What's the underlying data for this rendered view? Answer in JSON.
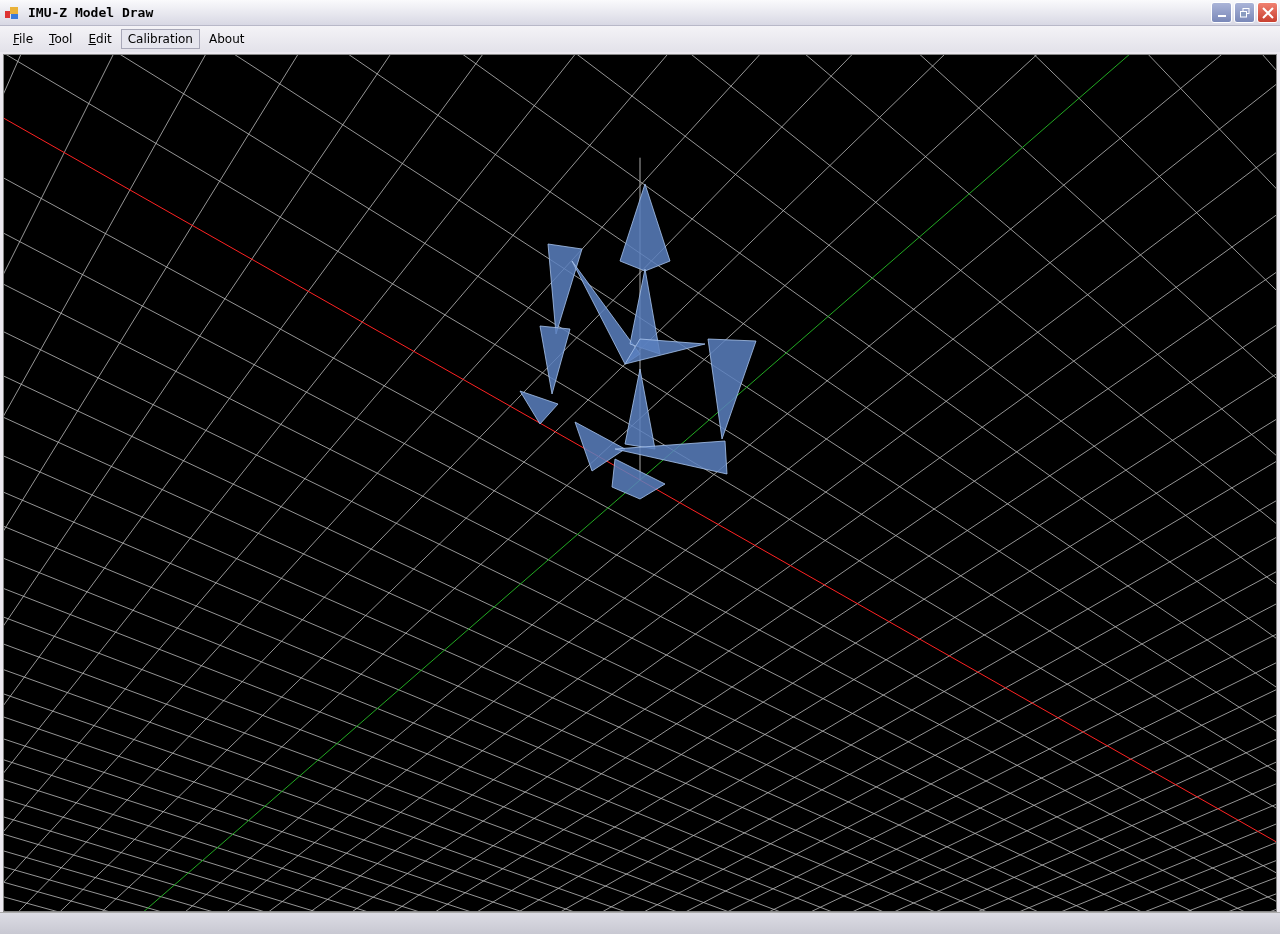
{
  "window": {
    "title": "IMU-Z Model Draw"
  },
  "menu": [
    {
      "label": "File",
      "underline_first": true,
      "selected": false
    },
    {
      "label": "Tool",
      "underline_first": true,
      "selected": false
    },
    {
      "label": "Edit",
      "underline_first": true,
      "selected": false
    },
    {
      "label": "Calibration",
      "underline_first": false,
      "selected": true
    },
    {
      "label": "About",
      "underline_first": false,
      "selected": false
    }
  ]
}
